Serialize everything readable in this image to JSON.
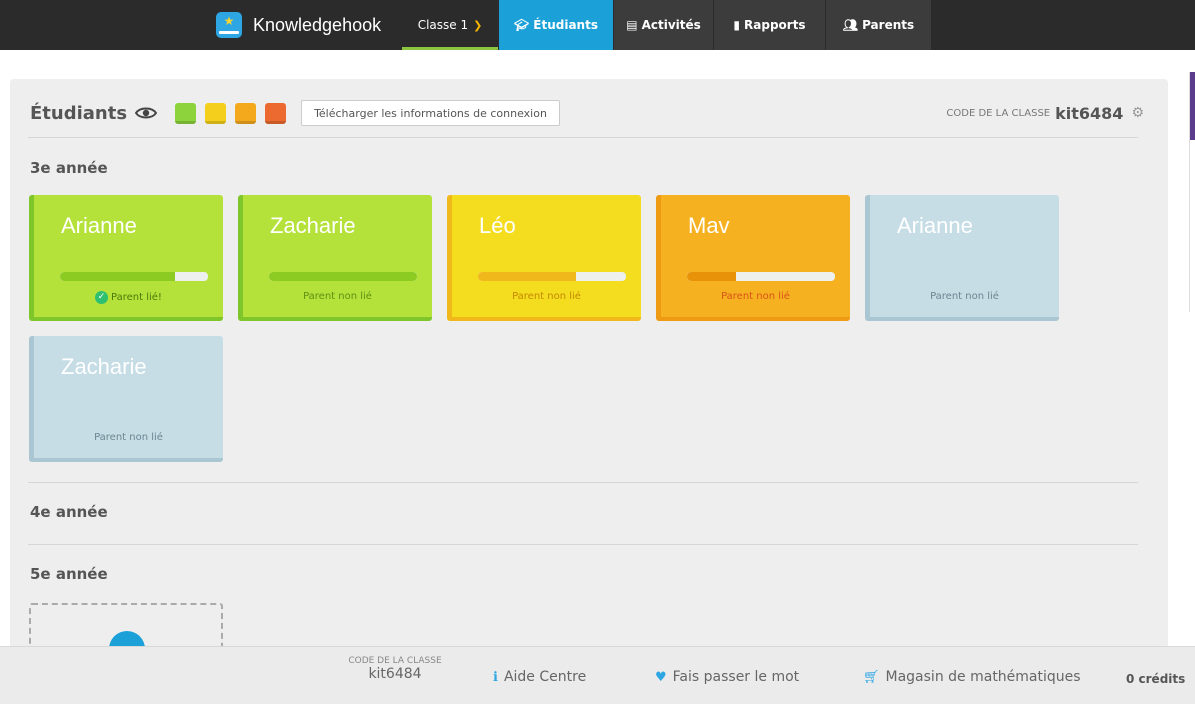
{
  "nav": {
    "brand": "Knowledgehook",
    "brand_icon": "star-book-icon",
    "class_label": "Classe 1",
    "tabs": [
      {
        "label": "Étudiants",
        "icon": "graduation-cap-icon",
        "active": true
      },
      {
        "label": "Activités",
        "icon": "book-icon",
        "active": false
      },
      {
        "label": "Rapports",
        "icon": "bar-chart-icon",
        "active": false
      },
      {
        "label": "Parents",
        "icon": "users-icon",
        "active": false
      }
    ]
  },
  "panel": {
    "title": "Étudiants",
    "swatches": [
      "#8cd33c",
      "#f4cf1c",
      "#f4a91d",
      "#ec6a30"
    ],
    "download_label": "Télécharger les informations de connexion",
    "class_code_label": "CODE DE LA CLASSE",
    "class_code": "kit6484"
  },
  "grades": [
    {
      "title": "3e année",
      "students": [
        {
          "name": "Arianne",
          "progress": 0.78,
          "status": "Parent lié!",
          "linked": true,
          "color": "green"
        },
        {
          "name": "Zacharie",
          "progress": 1.0,
          "status": "Parent non lié",
          "linked": false,
          "color": "green"
        },
        {
          "name": "Léo",
          "progress": 0.66,
          "status": "Parent non lié",
          "linked": false,
          "color": "yellow"
        },
        {
          "name": "Mav",
          "progress": 0.33,
          "status": "Parent non lié",
          "linked": false,
          "color": "orange"
        },
        {
          "name": "Arianne",
          "progress": null,
          "status": "Parent non lié",
          "linked": false,
          "color": "blue"
        },
        {
          "name": "Zacharie",
          "progress": null,
          "status": "Parent non lié",
          "linked": false,
          "color": "blue"
        }
      ]
    },
    {
      "title": "4e année",
      "students": []
    },
    {
      "title": "5e année",
      "students": []
    }
  ],
  "footer": {
    "class_code_label": "CODE DE LA CLASSE",
    "class_code": "kit6484",
    "help": "Aide Centre",
    "share": "Fais passer le mot",
    "store": "Magasin de mathématiques",
    "credits": "0 crédits"
  }
}
